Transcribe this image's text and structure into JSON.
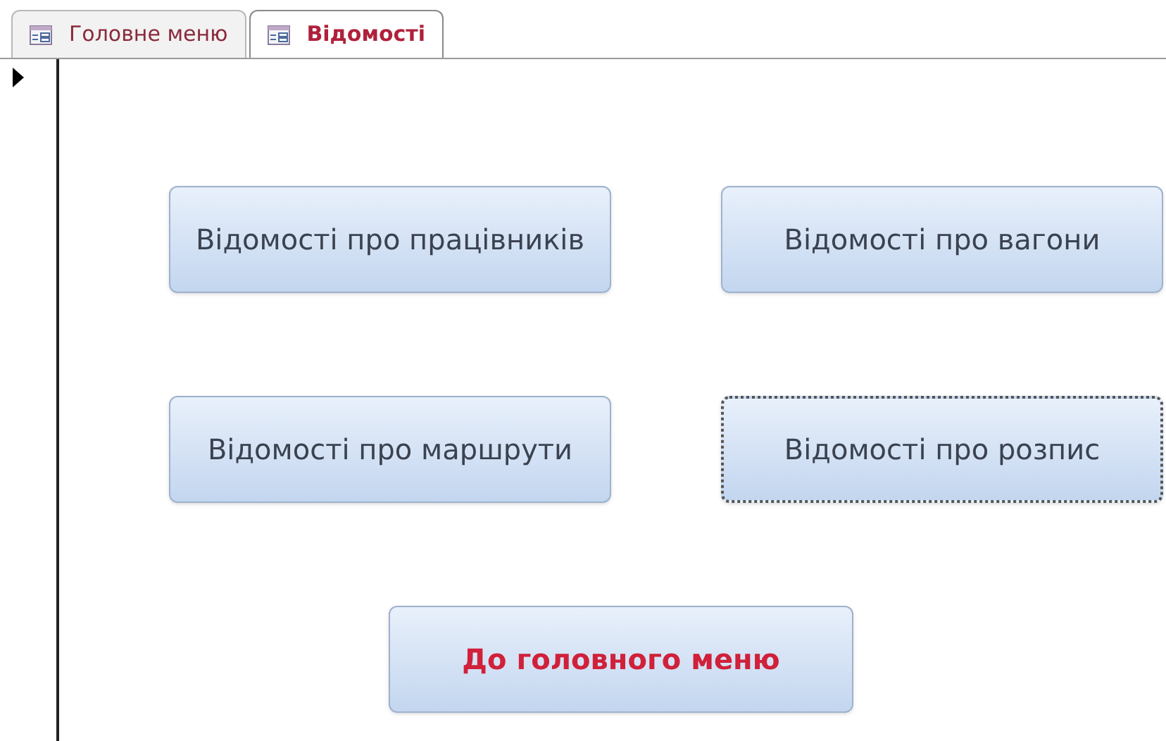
{
  "tabs": [
    {
      "label": "Головне меню",
      "selected": false
    },
    {
      "label": "Відомості",
      "selected": true
    }
  ],
  "buttons": [
    {
      "label": "Відомості про працівників",
      "kind": "report",
      "focused": false
    },
    {
      "label": "Відомості про вагони",
      "kind": "report",
      "focused": false
    },
    {
      "label": "Відомості про маршрути",
      "kind": "report",
      "focused": false
    },
    {
      "label": "Відомості про розпис",
      "kind": "report",
      "focused": true
    },
    {
      "label": "До головного меню",
      "kind": "back",
      "focused": false
    }
  ]
}
